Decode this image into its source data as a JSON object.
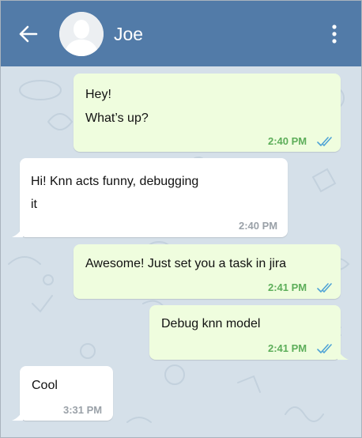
{
  "header": {
    "contact_name": "Joe",
    "bar_color": "#527ba8",
    "icons": [
      "back-arrow-icon",
      "avatar-placeholder-icon",
      "more-vertical-icon"
    ]
  },
  "messages": [
    {
      "direction": "outgoing",
      "text": "Hey!\nWhat’s up?",
      "time": "2:40 PM",
      "status": "read"
    },
    {
      "direction": "incoming",
      "text": "Hi! Knn acts funny, debugging\nit",
      "time": "2:40 PM"
    },
    {
      "direction": "outgoing",
      "text": "Awesome! Just set you a task in jira",
      "time": "2:41 PM",
      "status": "read"
    },
    {
      "direction": "outgoing",
      "text": "Debug knn model",
      "time": "2:41 PM",
      "status": "read"
    },
    {
      "direction": "incoming",
      "text": "Cool",
      "time": "3:31 PM"
    }
  ],
  "colors": {
    "chat_background": "#d5e0e9",
    "outgoing_bubble": "#effdde",
    "incoming_bubble": "#ffffff",
    "read_time": "#5dae5a"
  }
}
